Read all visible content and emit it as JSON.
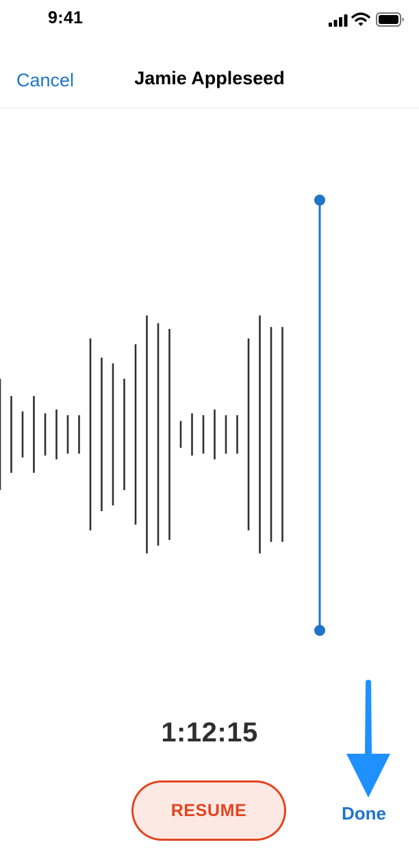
{
  "status_bar": {
    "time": "9:41",
    "icons": [
      "cellular-signal-icon",
      "wifi-icon",
      "battery-icon"
    ]
  },
  "nav": {
    "cancel_label": "Cancel",
    "title": "Jamie Appleseed"
  },
  "recording": {
    "elapsed": "1:12:15",
    "waveform_amplitudes": [
      0.29,
      0.2,
      0.12,
      0.2,
      0.11,
      0.13,
      0.1,
      0.1,
      0.5,
      0.4,
      0.37,
      0.29,
      0.47,
      0.62,
      0.58,
      0.55,
      0.07,
      0.11,
      0.1,
      0.13,
      0.1,
      0.1,
      0.5,
      0.62,
      0.56,
      0.56
    ],
    "playhead_color": "#1f74c7",
    "waveform_color": "#2f2f2f"
  },
  "actions": {
    "resume_label": "RESUME",
    "done_label": "Done"
  },
  "colors": {
    "accent": "#1f74c7",
    "record": "#e2441f",
    "record_fill": "#fde9e4",
    "arrow": "#1e90ff"
  }
}
